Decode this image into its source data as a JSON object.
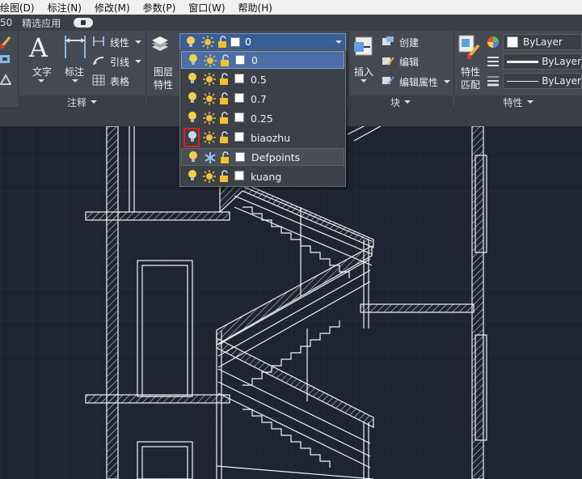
{
  "menubar": {
    "items": [
      "绘图(D)",
      "标注(N)",
      "修改(M)",
      "参数(P)",
      "窗口(W)",
      "帮助(H)"
    ]
  },
  "tabrow": {
    "items": [
      "50",
      "精选应用"
    ]
  },
  "ribbon": {
    "annotation": {
      "text_label": "文字",
      "dim_label": "标注",
      "linear_label": "线性",
      "leader_label": "引线",
      "table_label": "表格",
      "footer": "注释"
    },
    "layers": {
      "properties_label_1": "图层",
      "properties_label_2": "特性"
    },
    "block": {
      "insert_label": "插入",
      "create_label": "创建",
      "edit_label": "编辑",
      "edit_attr_label": "编辑属性",
      "footer": "块"
    },
    "properties": {
      "match_label_1": "特性",
      "match_label_2": "匹配",
      "color": "ByLayer",
      "linetype": "ByLayer",
      "lineweight": "ByLayer",
      "footer": "特性"
    }
  },
  "layer_dropdown": {
    "current": "0",
    "layers": [
      {
        "name": "0",
        "frozen": false,
        "selected": true
      },
      {
        "name": "0.5",
        "frozen": false
      },
      {
        "name": "0.7",
        "frozen": false
      },
      {
        "name": "0.25",
        "frozen": false
      },
      {
        "name": "biaozhu",
        "frozen": false,
        "highlighted_icon": true
      },
      {
        "name": "Defpoints",
        "frozen": true,
        "hover": true
      },
      {
        "name": "kuang",
        "frozen": false
      }
    ]
  },
  "colors": {
    "canvas": "#1e2430",
    "ribbon": "#454a52",
    "selection": "#4a6ea5",
    "highlight_border": "#e02020",
    "lightbulb": "#f3d24a",
    "sun": "#f0c040",
    "freeze": "#8fc8ff"
  }
}
